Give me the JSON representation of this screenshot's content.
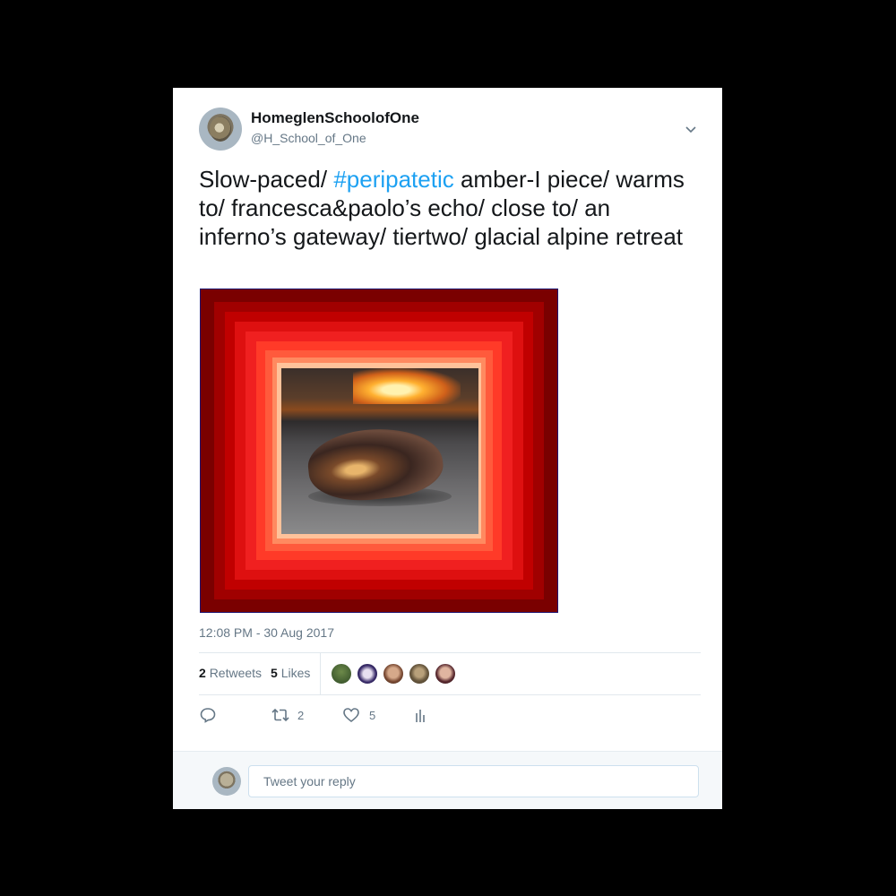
{
  "tweet": {
    "author_name": "HomeglenSchoolofOne",
    "author_handle": "@H_School_of_One",
    "text_before": "Slow-paced/ ",
    "hashtag": "#peripatetic",
    "text_after": " amber-I piece/ warms to/ francesca&paolo’s echo/ close to/ an inferno’s gateway/ tiertwo/ glacial alpine retreat",
    "timestamp": "12:08 PM - 30 Aug 2017"
  },
  "stats": {
    "retweets_count": "2",
    "retweets_label": "Retweets",
    "likes_count": "5",
    "likes_label": "Likes"
  },
  "actions": {
    "reply_icon": "reply-icon",
    "retweet_icon": "retweet-icon",
    "retweet_count": "2",
    "like_icon": "heart-icon",
    "like_count": "5",
    "analytics_icon": "analytics-icon"
  },
  "reply": {
    "placeholder": "Tweet your reply"
  },
  "colors": {
    "link": "#1da1f2",
    "muted": "#657786",
    "text": "#14171a"
  }
}
